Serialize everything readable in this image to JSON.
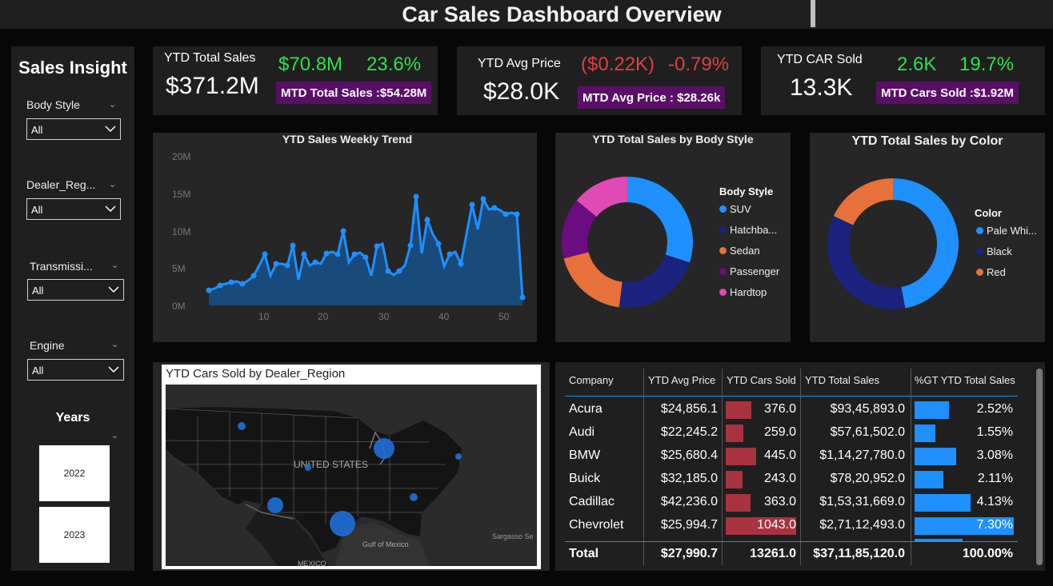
{
  "title": "Car Sales Dashboard Overview",
  "sidebar": {
    "heading": "Sales Insight",
    "slicers": [
      {
        "label": "Body Style",
        "value": "All"
      },
      {
        "label": "Dealer_Reg...",
        "value": "All"
      },
      {
        "label": "Transmissi...",
        "value": "All"
      },
      {
        "label": "Engine",
        "value": "All"
      }
    ],
    "years_label": "Years",
    "years": [
      "2022",
      "2023"
    ]
  },
  "kpis": {
    "sales": {
      "label": "YTD Total Sales",
      "value": "$371.2M",
      "delta_abs": "$70.8M",
      "delta_pct": "23.6%",
      "mtd": "MTD Total Sales :$54.28M"
    },
    "price": {
      "label": "YTD Avg Price",
      "value": "$28.0K",
      "delta_abs": "($0.22K)",
      "delta_pct": "-0.79%",
      "mtd": "MTD Avg Price : $28.26k"
    },
    "cars": {
      "label": "YTD CAR Sold",
      "value": "13.3K",
      "delta_abs": "2.6K",
      "delta_pct": "19.7%",
      "mtd": "MTD Cars Sold :$1.92M"
    }
  },
  "colors": {
    "accent_blue": "#1e90ff",
    "positive": "#2ee04e",
    "negative": "#e04040",
    "badge": "#5a0f66",
    "table_red_bar": "#a8323e"
  },
  "trend": {
    "title": "YTD Sales Weekly Trend",
    "y_ticks": [
      "20M",
      "15M",
      "10M",
      "5M",
      "0M"
    ],
    "x_ticks": [
      "10",
      "20",
      "30",
      "40",
      "50"
    ]
  },
  "body_style_chart": {
    "title": "YTD Total Sales by Body Style",
    "legend_title": "Body Style",
    "items": [
      {
        "label": "SUV",
        "value": 30,
        "color": "#1e90ff"
      },
      {
        "label": "Hatchba...",
        "value": 22,
        "color": "#1a237e"
      },
      {
        "label": "Sedan",
        "value": 19,
        "color": "#e8703a"
      },
      {
        "label": "Passenger",
        "value": 15,
        "color": "#6a0d83"
      },
      {
        "label": "Hardtop",
        "value": 14,
        "color": "#e04ab4"
      }
    ]
  },
  "color_chart": {
    "title": "YTD Total Sales by Color",
    "legend_title": "Color",
    "items": [
      {
        "label": "Pale Whi...",
        "value": 47,
        "color": "#1e90ff"
      },
      {
        "label": "Black",
        "value": 35,
        "color": "#1a237e"
      },
      {
        "label": "Red",
        "value": 18,
        "color": "#e8703a"
      }
    ]
  },
  "map": {
    "title": "YTD Cars Sold by Dealer_Region",
    "labels": {
      "country": "UNITED STATES",
      "gulf": "Gulf of Mexico",
      "mexico": "MEXICO",
      "sea": "Sargasso Se"
    }
  },
  "table": {
    "headers": [
      "Company",
      "YTD Avg Price",
      "YTD Cars Sold",
      "YTD Total Sales",
      "%GT YTD Total Sales"
    ],
    "rows": [
      {
        "company": "Acura",
        "avg": "$24,856.1",
        "sold": "376.0",
        "total": "$93,45,893.0",
        "pct": "2.52%",
        "sold_n": 376,
        "pct_n": 2.52
      },
      {
        "company": "Audi",
        "avg": "$22,245.2",
        "sold": "259.0",
        "total": "$57,61,502.0",
        "pct": "1.55%",
        "sold_n": 259,
        "pct_n": 1.55
      },
      {
        "company": "BMW",
        "avg": "$25,680.4",
        "sold": "445.0",
        "total": "$1,14,27,780.0",
        "pct": "3.08%",
        "sold_n": 445,
        "pct_n": 3.08
      },
      {
        "company": "Buick",
        "avg": "$32,185.0",
        "sold": "243.0",
        "total": "$78,20,952.0",
        "pct": "2.11%",
        "sold_n": 243,
        "pct_n": 2.11
      },
      {
        "company": "Cadillac",
        "avg": "$42,236.0",
        "sold": "363.0",
        "total": "$1,53,31,669.0",
        "pct": "4.13%",
        "sold_n": 363,
        "pct_n": 4.13
      },
      {
        "company": "Chevrolet",
        "avg": "$25,994.7",
        "sold": "1043.0",
        "total": "$2,71,12,493.0",
        "pct": "7.30%",
        "sold_n": 1043,
        "pct_n": 7.3
      }
    ],
    "total": {
      "label": "Total",
      "avg": "$27,990.7",
      "sold": "13261.0",
      "total": "$37,11,85,120.0",
      "pct": "100.00%"
    }
  }
}
